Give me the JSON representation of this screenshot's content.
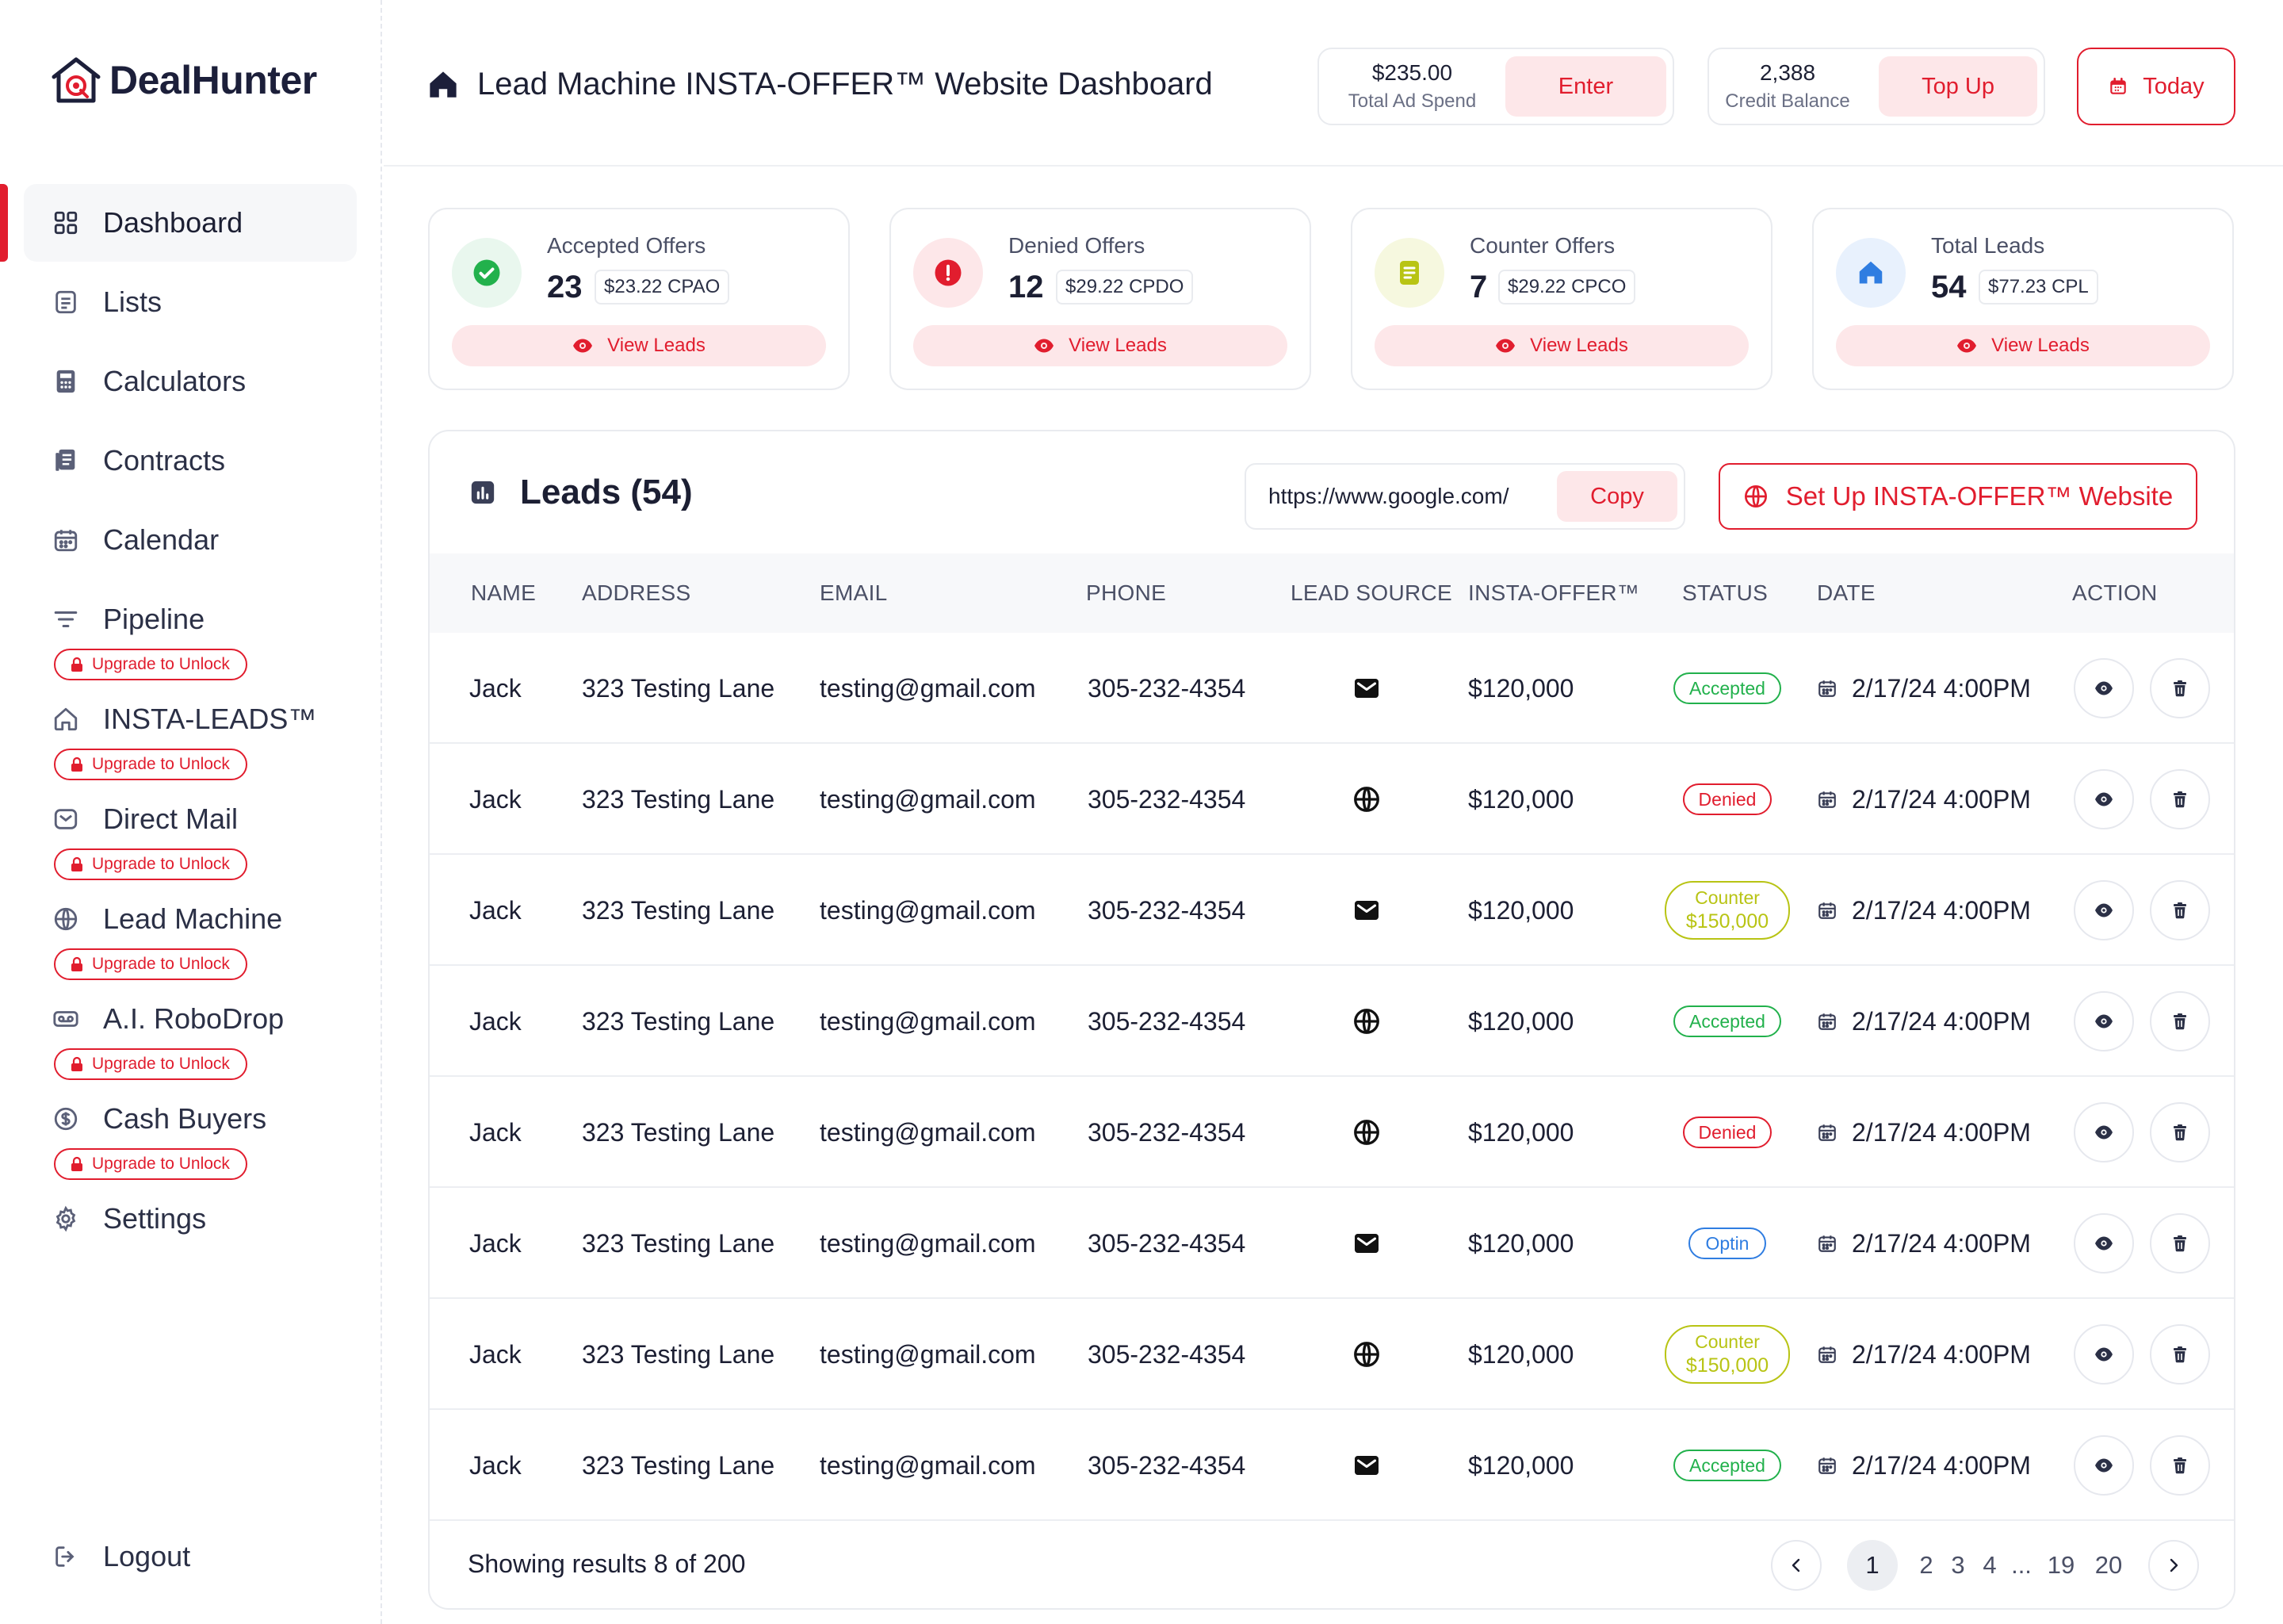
{
  "brand": {
    "name": "DealHunter",
    "accent": "#e11d2e"
  },
  "sidebar": {
    "items": [
      {
        "label": "Dashboard",
        "icon": "grid-icon",
        "active": true
      },
      {
        "label": "Lists",
        "icon": "list-icon"
      },
      {
        "label": "Calculators",
        "icon": "calculator-icon"
      },
      {
        "label": "Contracts",
        "icon": "contract-icon"
      },
      {
        "label": "Calendar",
        "icon": "calendar-icon"
      },
      {
        "label": "Pipeline",
        "icon": "filter-icon",
        "locked": true
      },
      {
        "label": "INSTA-LEADS™",
        "icon": "home-icon",
        "locked": true
      },
      {
        "label": "Direct Mail",
        "icon": "mail-icon",
        "locked": true
      },
      {
        "label": "Lead Machine",
        "icon": "globe-icon",
        "locked": true
      },
      {
        "label": "A.I. RoboDrop",
        "icon": "voicemail-icon",
        "locked": true
      },
      {
        "label": "Cash Buyers",
        "icon": "dollar-icon",
        "locked": true
      },
      {
        "label": "Settings",
        "icon": "gear-icon"
      }
    ],
    "upgrade_label": "Upgrade to Unlock",
    "logout_label": "Logout"
  },
  "header": {
    "title": "Lead Machine INSTA-OFFER™ Website Dashboard",
    "ad_spend": {
      "value": "$235.00",
      "label": "Total Ad Spend",
      "button": "Enter"
    },
    "credits": {
      "value": "2,388",
      "label": "Credit Balance",
      "button": "Top Up"
    },
    "date_button": "Today"
  },
  "cards": [
    {
      "title": "Accepted Offers",
      "value": "23",
      "metric": "$23.22 CPAO",
      "button": "View Leads",
      "icon": "check-circle-icon",
      "color": "#22b14c"
    },
    {
      "title": "Denied Offers",
      "value": "12",
      "metric": "$29.22 CPDO",
      "button": "View Leads",
      "icon": "alert-circle-icon",
      "color": "#e11d2e"
    },
    {
      "title": "Counter Offers",
      "value": "7",
      "metric": "$29.22 CPCO",
      "button": "View Leads",
      "icon": "document-icon",
      "color": "#b8c414"
    },
    {
      "title": "Total Leads",
      "value": "54",
      "metric": "$77.23 CPL",
      "button": "View Leads",
      "icon": "home-icon",
      "color": "#2f7de1"
    }
  ],
  "leads": {
    "title": "Leads (54)",
    "url": "https://www.google.com/",
    "copy_label": "Copy",
    "setup_label": "Set Up INSTA-OFFER™ Website",
    "columns": [
      "NAME",
      "ADDRESS",
      "EMAIL",
      "PHONE",
      "LEAD SOURCE",
      "INSTA-OFFER™",
      "STATUS",
      "DATE",
      "ACTION"
    ],
    "rows": [
      {
        "name": "Jack",
        "address": "323 Testing Lane",
        "email": "testing@gmail.com",
        "phone": "305-232-4354",
        "source": "mail-icon",
        "offer": "$120,000",
        "status": "Accepted",
        "status_type": "accepted",
        "date": "2/17/24 4:00PM"
      },
      {
        "name": "Jack",
        "address": "323 Testing Lane",
        "email": "testing@gmail.com",
        "phone": "305-232-4354",
        "source": "globe-icon",
        "offer": "$120,000",
        "status": "Denied",
        "status_type": "denied",
        "date": "2/17/24 4:00PM"
      },
      {
        "name": "Jack",
        "address": "323 Testing Lane",
        "email": "testing@gmail.com",
        "phone": "305-232-4354",
        "source": "mail-icon",
        "offer": "$120,000",
        "status": "Counter",
        "status_sub": "$150,000",
        "status_type": "counter",
        "date": "2/17/24 4:00PM"
      },
      {
        "name": "Jack",
        "address": "323 Testing Lane",
        "email": "testing@gmail.com",
        "phone": "305-232-4354",
        "source": "globe-icon",
        "offer": "$120,000",
        "status": "Accepted",
        "status_type": "accepted",
        "date": "2/17/24 4:00PM"
      },
      {
        "name": "Jack",
        "address": "323 Testing Lane",
        "email": "testing@gmail.com",
        "phone": "305-232-4354",
        "source": "globe-icon",
        "offer": "$120,000",
        "status": "Denied",
        "status_type": "denied",
        "date": "2/17/24 4:00PM"
      },
      {
        "name": "Jack",
        "address": "323 Testing Lane",
        "email": "testing@gmail.com",
        "phone": "305-232-4354",
        "source": "mail-icon",
        "offer": "$120,000",
        "status": "Optin",
        "status_type": "optin",
        "date": "2/17/24 4:00PM"
      },
      {
        "name": "Jack",
        "address": "323 Testing Lane",
        "email": "testing@gmail.com",
        "phone": "305-232-4354",
        "source": "globe-icon",
        "offer": "$120,000",
        "status": "Counter",
        "status_sub": "$150,000",
        "status_type": "counter",
        "date": "2/17/24 4:00PM"
      },
      {
        "name": "Jack",
        "address": "323 Testing Lane",
        "email": "testing@gmail.com",
        "phone": "305-232-4354",
        "source": "mail-icon",
        "offer": "$120,000",
        "status": "Accepted",
        "status_type": "accepted",
        "date": "2/17/24 4:00PM"
      }
    ],
    "footer": "Showing results 8 of 200",
    "pagination": {
      "current": "1",
      "pages": [
        "2",
        "3",
        "4"
      ],
      "ellipsis": "...",
      "last_pages": [
        "19",
        "20"
      ]
    }
  }
}
